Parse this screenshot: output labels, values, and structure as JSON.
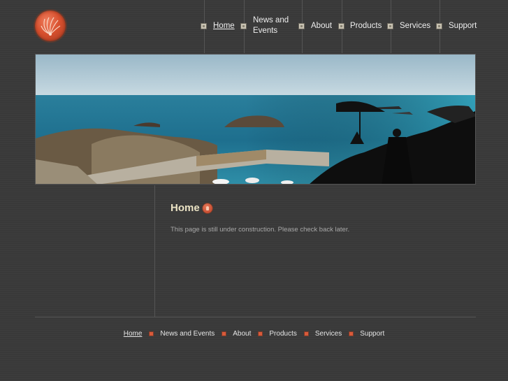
{
  "nav": {
    "items": [
      {
        "label": "Home",
        "active": true
      },
      {
        "label": "News and Events",
        "active": false
      },
      {
        "label": "About",
        "active": false
      },
      {
        "label": "Products",
        "active": false
      },
      {
        "label": "Services",
        "active": false
      },
      {
        "label": "Support",
        "active": false
      }
    ]
  },
  "content": {
    "title": "Home",
    "body": "This page is still under construction. Please check back later."
  },
  "footer": {
    "items": [
      "Home",
      "News and Events",
      "About",
      "Products",
      "Services",
      "Support"
    ]
  },
  "colors": {
    "background": "#393939",
    "heading": "#eae2c4",
    "accent": "#d85a3a",
    "body_text": "#a8a8a8"
  },
  "icons": {
    "logo": "orange-shell-logo",
    "heading": "orange-badge-icon",
    "nav_bullet": "square-bullet-icon",
    "footer_bullet": "orange-square-bullet-icon"
  }
}
